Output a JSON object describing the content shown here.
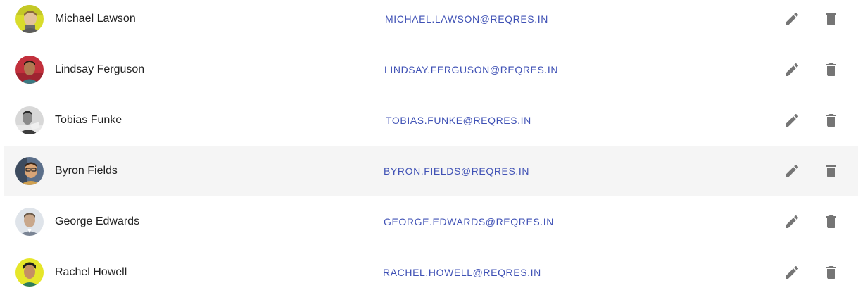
{
  "users": [
    {
      "name": "Michael Lawson",
      "email": "MICHAEL.LAWSON@REQRES.IN",
      "avatar": "michael-lawson-avatar"
    },
    {
      "name": "Lindsay Ferguson",
      "email": "LINDSAY.FERGUSON@REQRES.IN",
      "avatar": "lindsay-ferguson-avatar"
    },
    {
      "name": "Tobias Funke",
      "email": "TOBIAS.FUNKE@REQRES.IN",
      "avatar": "tobias-funke-avatar"
    },
    {
      "name": "Byron Fields",
      "email": "BYRON.FIELDS@REQRES.IN",
      "avatar": "byron-fields-avatar"
    },
    {
      "name": "George Edwards",
      "email": "GEORGE.EDWARDS@REQRES.IN",
      "avatar": "george-edwards-avatar"
    },
    {
      "name": "Rachel Howell",
      "email": "RACHEL.HOWELL@REQRES.IN",
      "avatar": "rachel-howell-avatar"
    }
  ],
  "icons": {
    "edit": "pencil-icon",
    "delete": "trash-icon"
  },
  "colors": {
    "email_link": "#3f51b5",
    "icon": "#757575",
    "hover_row": "#f5f5f5",
    "name_text": "#212121"
  }
}
